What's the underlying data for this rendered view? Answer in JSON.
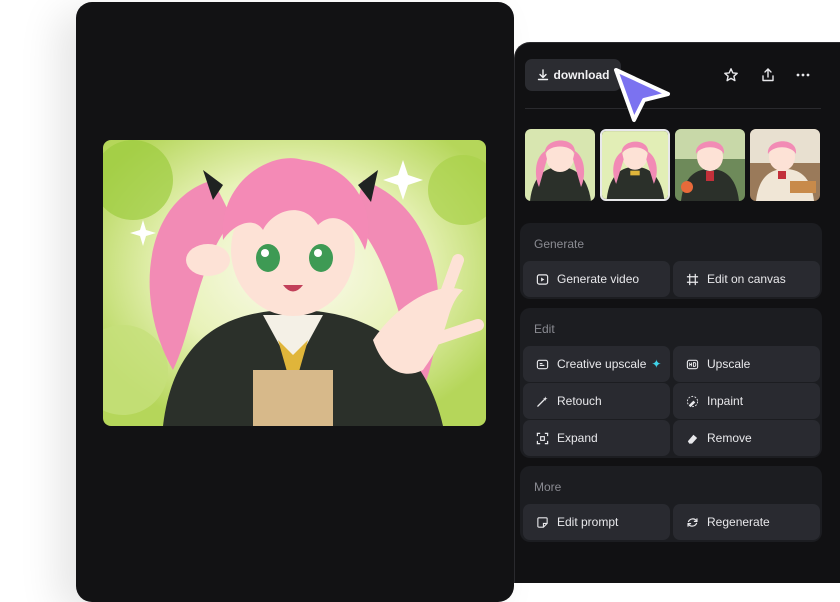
{
  "toolbar": {
    "download_label": "download",
    "icons": [
      "download-icon",
      "star-icon",
      "share-icon",
      "more-icon"
    ]
  },
  "thumbnails": [
    {
      "name": "variant-1",
      "selected": false
    },
    {
      "name": "variant-2",
      "selected": true
    },
    {
      "name": "variant-3",
      "selected": false
    },
    {
      "name": "variant-4",
      "selected": false
    }
  ],
  "generate": {
    "title": "Generate",
    "generate_video": "Generate video",
    "edit_on_canvas": "Edit on canvas"
  },
  "edit": {
    "title": "Edit",
    "creative_upscale": "Creative upscale",
    "upscale": "Upscale",
    "retouch": "Retouch",
    "inpaint": "Inpaint",
    "expand": "Expand",
    "remove": "Remove"
  },
  "more": {
    "title": "More",
    "edit_prompt": "Edit prompt",
    "regenerate": "Regenerate"
  },
  "colors": {
    "panel_bg": "#111113",
    "section_bg": "#1c1d21",
    "button_bg": "#292a30",
    "accent_cursor": "#7b72f0",
    "sparkle": "#3fd2e8"
  }
}
